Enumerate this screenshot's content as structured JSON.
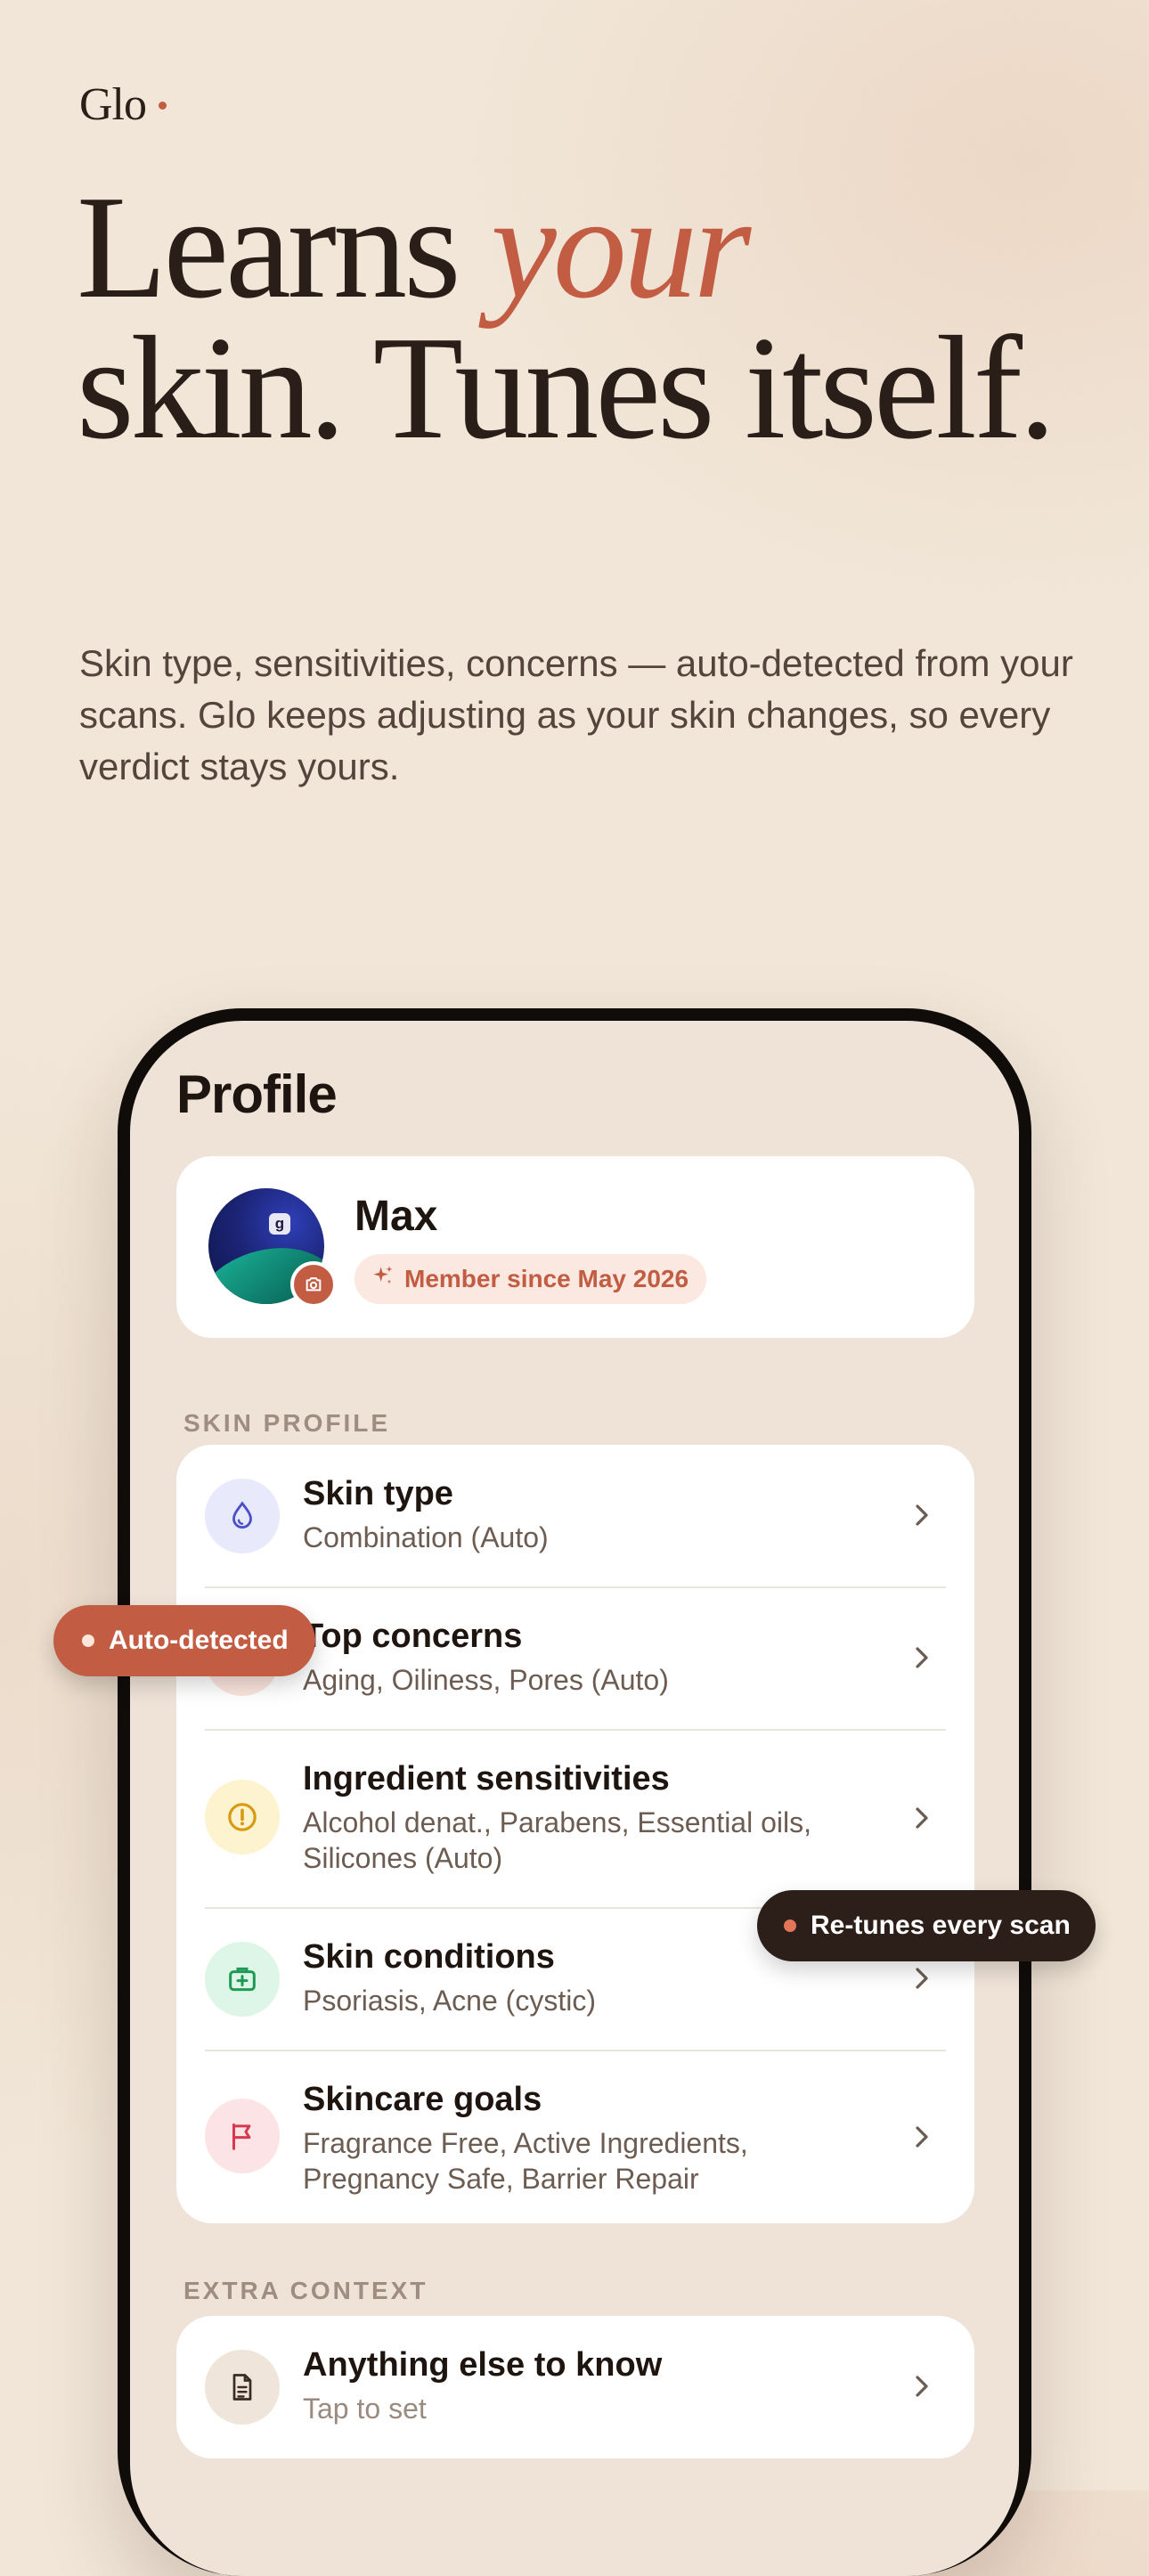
{
  "brand": {
    "name": "Glo"
  },
  "headline": {
    "part1": "Learns ",
    "emphasis": "your",
    "part2": "skin. Tunes itself."
  },
  "subheadline": "Skin type, sensitivities, concerns — auto-detected from your scans. Glo keeps adjusting as your skin changes, so every verdict stays yours.",
  "colors": {
    "accent": "#c25c43",
    "dark": "#2a1e18",
    "background": "#f1e6d8"
  },
  "app": {
    "title": "Profile",
    "user": {
      "name": "Max",
      "member_since": "Member since May 2026",
      "badge_icon": "sparkle-icon",
      "avatar_action_icon": "camera-icon",
      "avatar_glyph": "g"
    },
    "skin_profile": {
      "section_label": "SKIN PROFILE",
      "items": [
        {
          "title": "Skin type",
          "subtitle": "Combination (Auto)",
          "icon": "droplet-icon",
          "icon_bg": "#e8e9fb",
          "icon_color": "#4b50c8"
        },
        {
          "title": "Top concerns",
          "subtitle": "Aging, Oiliness, Pores (Auto)",
          "icon": "target-icon",
          "icon_bg": "#fbe4dd",
          "icon_color": "#c25c43"
        },
        {
          "title": "Ingredient sensitivities",
          "subtitle": "Alcohol denat., Parabens, Essential oils, Silicones (Auto)",
          "icon": "alert-circle-icon",
          "icon_bg": "#fdf3cf",
          "icon_color": "#d99a12"
        },
        {
          "title": "Skin conditions",
          "subtitle": "Psoriasis, Acne (cystic)",
          "icon": "medical-kit-icon",
          "icon_bg": "#ddf6e7",
          "icon_color": "#1f9a55"
        },
        {
          "title": "Skincare goals",
          "subtitle": "Fragrance Free, Active Ingredients, Pregnancy Safe, Barrier Repair",
          "icon": "flag-icon",
          "icon_bg": "#fce4e6",
          "icon_color": "#d6394c"
        }
      ]
    },
    "extra_context": {
      "section_label": "EXTRA CONTEXT",
      "items": [
        {
          "title": "Anything else to know",
          "subtitle": "Tap to set",
          "icon": "document-icon",
          "icon_bg": "#efe5da",
          "icon_color": "#3a2c24"
        }
      ]
    }
  },
  "callouts": {
    "auto_detected": "Auto-detected",
    "retunes": "Re-tunes every scan"
  }
}
